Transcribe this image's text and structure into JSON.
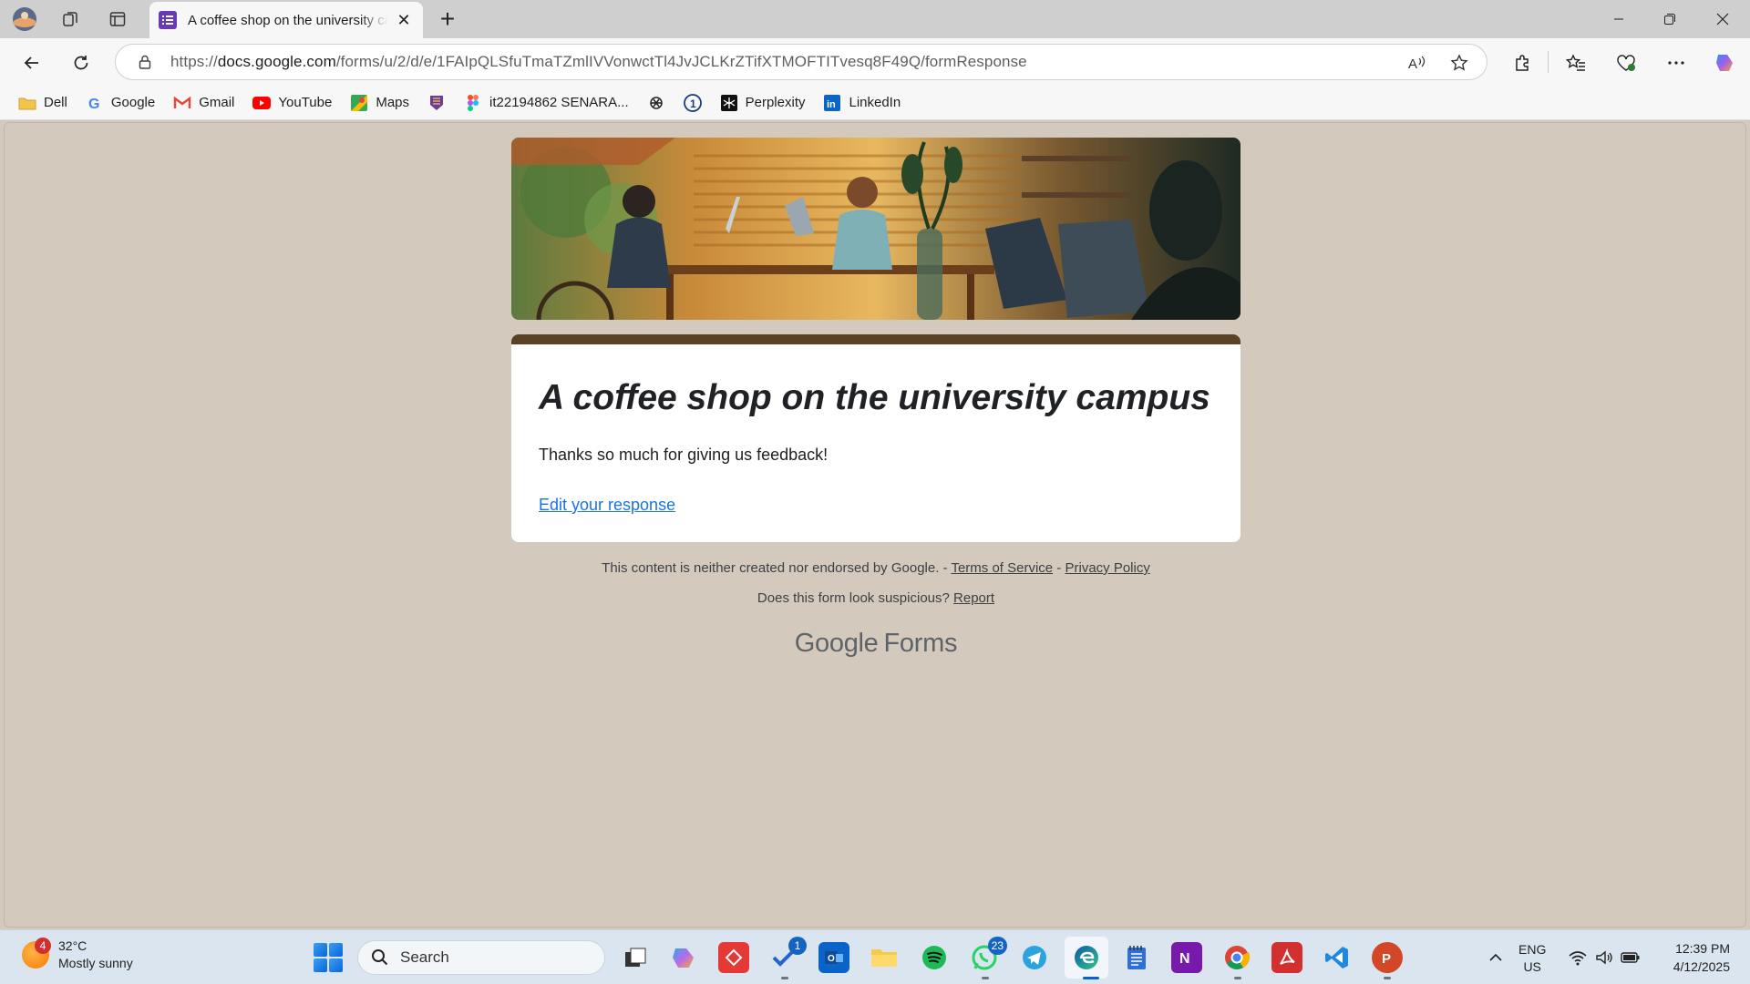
{
  "browser": {
    "tab": {
      "title": "A coffee shop on the university campus"
    },
    "address": {
      "url_prefix": "https://",
      "url_host": "docs.google.com",
      "url_path": "/forms/u/2/d/e/1FAIpQLSfuTmaTZmlIVVonwctTl4JvJCLKrZTifXTMOFTITvesq8F49Q/formResponse"
    },
    "bookmarks": [
      {
        "label": "Dell",
        "icon": "folder-icon",
        "color": "#f2c54b"
      },
      {
        "label": "Google",
        "icon": "google-icon",
        "color": "#4285f4"
      },
      {
        "label": "Gmail",
        "icon": "gmail-icon",
        "color": "#ea4335"
      },
      {
        "label": "YouTube",
        "icon": "youtube-icon",
        "color": "#ff0000"
      },
      {
        "label": "Maps",
        "icon": "maps-icon",
        "color": "#34a853"
      },
      {
        "label": "",
        "icon": "university-icon",
        "color": "#6a3d9a"
      },
      {
        "label": "it22194862 SENARA...",
        "icon": "figma-icon",
        "color": "#f24e1e"
      },
      {
        "label": "",
        "icon": "openai-icon",
        "color": "#222222"
      },
      {
        "label": "",
        "icon": "onepassword-icon",
        "color": "#1a6fd8"
      },
      {
        "label": "Perplexity",
        "icon": "perplexity-icon",
        "color": "#111111"
      },
      {
        "label": "LinkedIn",
        "icon": "linkedin-icon",
        "color": "#0a66c2"
      }
    ]
  },
  "form": {
    "title": "A coffee shop on the university campus",
    "confirmation": "Thanks so much for giving us feedback!",
    "edit_link": "Edit your response",
    "accent_color": "#5a4125"
  },
  "footer": {
    "disclaimer": "This content is neither created nor endorsed by Google.",
    "separator": " - ",
    "terms": "Terms of Service",
    "privacy": "Privacy Policy",
    "suspicious": "Does this form look suspicious?",
    "report": "Report",
    "brand_google": "Google",
    "brand_forms": "Forms"
  },
  "taskbar": {
    "weather_badge": "4",
    "temperature": "32°C",
    "condition": "Mostly sunny",
    "search_label": "Search",
    "todo_badge": "1",
    "whatsapp_badge": "23",
    "language_1": "ENG",
    "language_2": "US",
    "time": "12:39 PM",
    "date": "4/12/2025"
  }
}
